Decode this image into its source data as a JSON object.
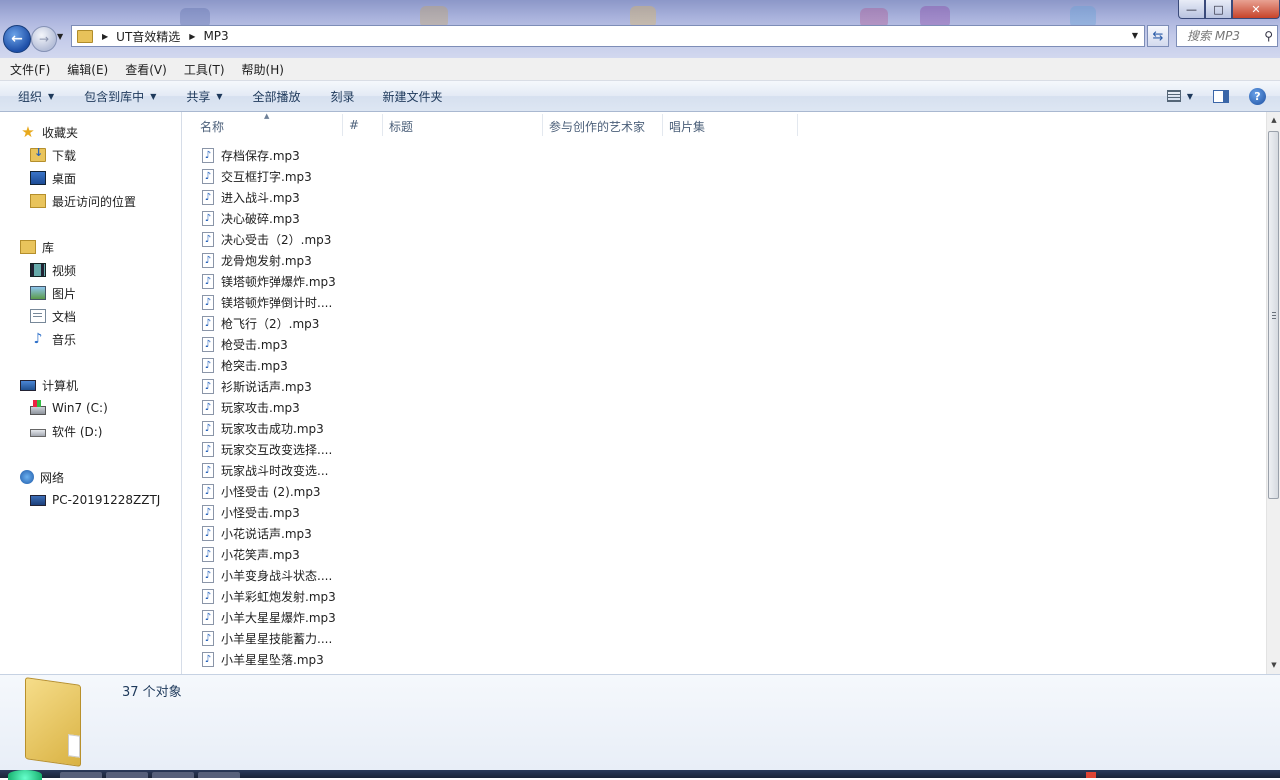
{
  "window": {
    "buttons": {
      "minimize": "—",
      "maximize": "□",
      "close": "✕"
    }
  },
  "address": {
    "crumbs": [
      "UT音效精选",
      "MP3"
    ]
  },
  "search": {
    "placeholder": "搜索 MP3"
  },
  "menu": [
    "文件(F)",
    "编辑(E)",
    "查看(V)",
    "工具(T)",
    "帮助(H)"
  ],
  "commands": {
    "organize": "组织",
    "include_library": "包含到库中",
    "share": "共享",
    "play_all": "全部播放",
    "burn": "刻录",
    "new_folder": "新建文件夹"
  },
  "nav": {
    "favorites": "收藏夹",
    "downloads": "下载",
    "desktop": "桌面",
    "recent": "最近访问的位置",
    "libraries": "库",
    "videos": "视频",
    "pictures": "图片",
    "documents": "文档",
    "music": "音乐",
    "computer": "计算机",
    "drive_c": "Win7 (C:)",
    "drive_d": "软件 (D:)",
    "network": "网络",
    "pc": "PC-20191228ZZTJ"
  },
  "columns": [
    "名称",
    "#",
    "标题",
    "参与创作的艺术家",
    "唱片集"
  ],
  "files": [
    "存档保存.mp3",
    "交互框打字.mp3",
    "进入战斗.mp3",
    "决心破碎.mp3",
    "决心受击（2）.mp3",
    "龙骨炮发射.mp3",
    "镁塔顿炸弹爆炸.mp3",
    "镁塔顿炸弹倒计时....",
    "枪飞行（2）.mp3",
    "枪受击.mp3",
    "枪突击.mp3",
    "衫斯说话声.mp3",
    "玩家攻击.mp3",
    "玩家攻击成功.mp3",
    "玩家交互改变选择....",
    "玩家战斗时改变选...",
    "小怪受击 (2).mp3",
    "小怪受击.mp3",
    "小花说话声.mp3",
    "小花笑声.mp3",
    "小羊变身战斗状态....",
    "小羊彩虹炮发射.mp3",
    "小羊大星星爆炸.mp3",
    "小羊星星技能蓄力....",
    "小羊星星坠落.mp3"
  ],
  "status": {
    "count": "37 个对象"
  },
  "colors": {
    "accent": "#1e395b",
    "folder": "#e9c45c"
  }
}
